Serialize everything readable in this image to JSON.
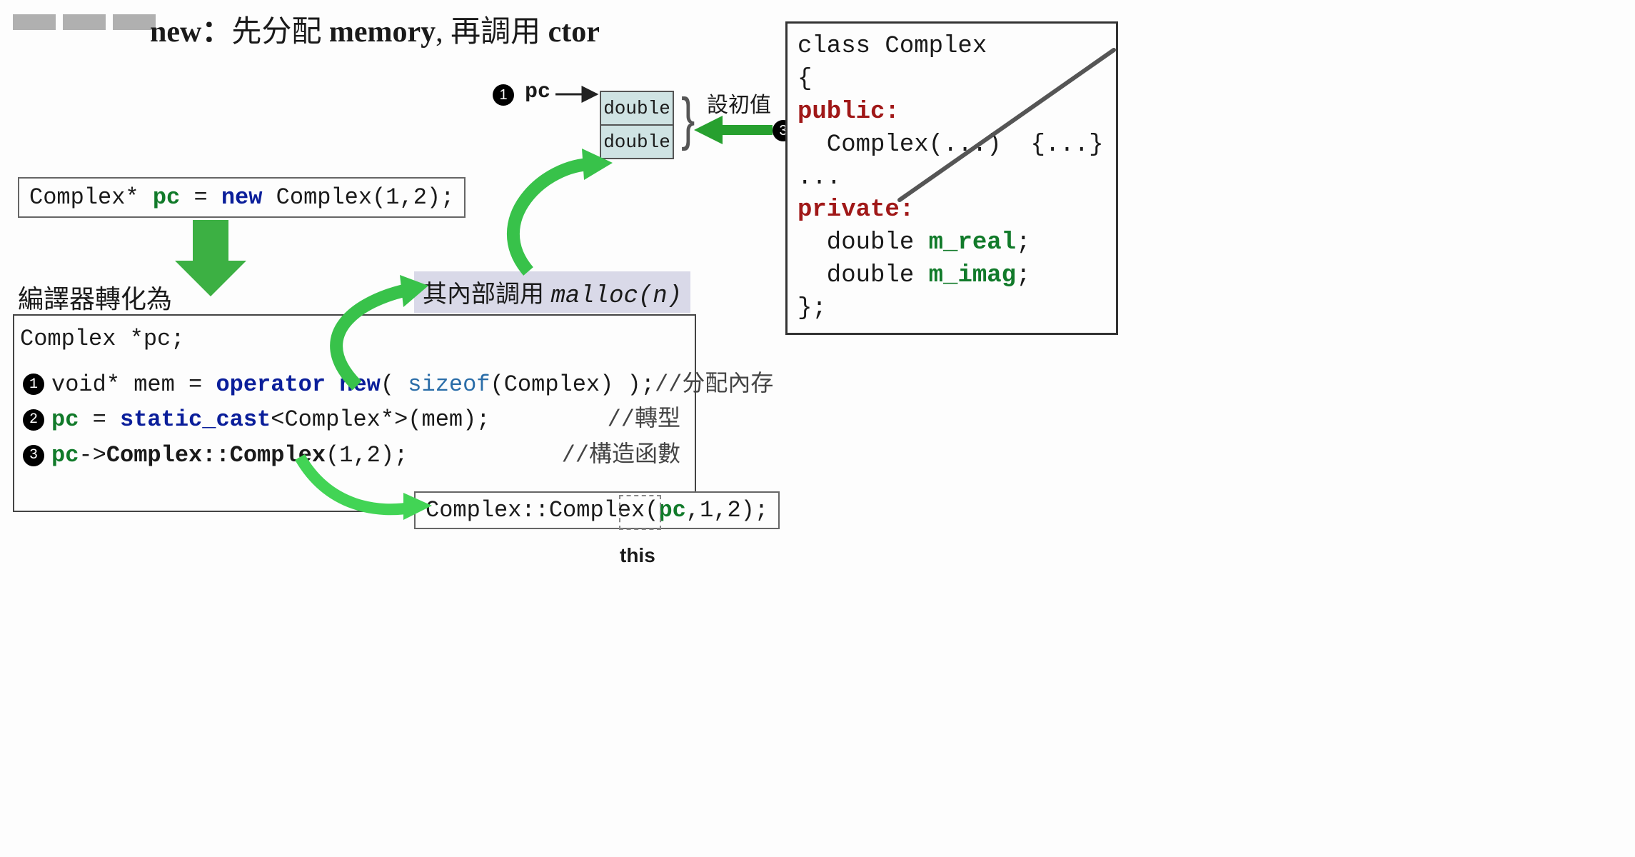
{
  "title": {
    "prefix": "new：",
    "cn1": "先分配 ",
    "en1": "memory",
    "cn2": ", 再調用 ",
    "en2": "ctor"
  },
  "code_top": {
    "t1": "Complex* ",
    "pc": "pc",
    "eq": " = ",
    "new": "new",
    "rest": " Complex(1,2);"
  },
  "label_compile": "編譯器轉化為",
  "box2": {
    "decl": "Complex *pc;",
    "l1_pre": "void* mem = ",
    "l1_op": "operator new",
    "l1_mid": "( ",
    "l1_sizeof": "sizeof",
    "l1_post": "(Complex) );",
    "c1": "//分配內存",
    "l2_pc": "pc",
    "l2_mid1": " = ",
    "l2_cast": "static_cast",
    "l2_mid2": "<Complex*>(mem);",
    "c2": "//轉型",
    "l3_pc": "pc",
    "l3_arrow": "->",
    "l3_call": "Complex::Complex",
    "l3_args": "(1,2);",
    "c3": "//構造函數"
  },
  "box3": {
    "pre": "Complex::Complex(",
    "pc": "pc",
    "post": ",1,2);"
  },
  "this_label": "this",
  "malloc_label": {
    "cn": "其內部調用 ",
    "fn": "malloc(",
    "n": "n",
    "close": ")"
  },
  "pc_label": "pc",
  "bullets": {
    "b1": "1",
    "b2": "2",
    "b3": "3"
  },
  "mem_cells": [
    "double",
    "double"
  ],
  "init_label": "設初值",
  "classbox": {
    "l1": "class Complex",
    "l2": "{",
    "l3": "public:",
    "l4": "  Complex(...)  {...}",
    "l5": "...",
    "l6": "private:",
    "l7a": "  double ",
    "l7b": "m_real",
    "l8a": "  double ",
    "l8b": "m_imag",
    "semi": ";",
    "l9": "};"
  }
}
